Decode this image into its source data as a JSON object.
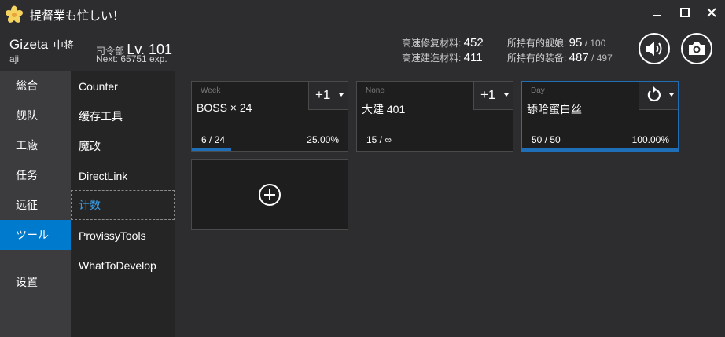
{
  "app": {
    "title": "提督業も忙しい！"
  },
  "admiral": {
    "name": "Gizeta",
    "rank": "中将",
    "comment": "aji",
    "hq_label": "司令部",
    "level": "Lv. 101",
    "next_exp": "Next: 65751 exp."
  },
  "resources": {
    "repair_label": "高速修复材料: ",
    "repair_value": "452",
    "build_label": "高速建造材料: ",
    "build_value": "411",
    "ships_label": "所持有的舰娘: ",
    "ships_value": "95",
    "ships_sep": " / ",
    "ships_max": "100",
    "equip_label": "所持有的装备: ",
    "equip_value": "487",
    "equip_sep": " / ",
    "equip_max": "497"
  },
  "nav_primary": [
    {
      "label": "総合",
      "active": false
    },
    {
      "label": "舰队",
      "active": false
    },
    {
      "label": "工廠",
      "active": false
    },
    {
      "label": "任务",
      "active": false
    },
    {
      "label": "远征",
      "active": false
    },
    {
      "label": "ツール",
      "active": true
    },
    {
      "label": "设置",
      "active": false
    }
  ],
  "nav_secondary": [
    {
      "label": "Counter"
    },
    {
      "label": "缓存工具"
    },
    {
      "label": "魔改"
    },
    {
      "label": "DirectLink"
    },
    {
      "label": "计数",
      "selected": true
    },
    {
      "label": "ProvissyTools"
    },
    {
      "label": "WhatToDevelop"
    }
  ],
  "counters": [
    {
      "type": "Week",
      "name": "BOSS × 24",
      "count": "6 / 24",
      "percent": "25.00%",
      "progress": 0.25,
      "button_label": "+1",
      "button_icon": "plus-one"
    },
    {
      "type": "None",
      "name": "大建 401",
      "count": "15 / ∞",
      "percent": "",
      "progress": 0,
      "button_label": "+1",
      "button_icon": "plus-one"
    },
    {
      "type": "Day",
      "name": "舔哈蜜白丝",
      "count": "50 / 50",
      "percent": "100.00%",
      "progress": 1.0,
      "button_label": "",
      "button_icon": "reset-icon"
    }
  ],
  "colors": {
    "accent": "#007acc",
    "progress": "#1e6fb8",
    "selected_text": "#3aa0e8"
  },
  "icons": {
    "app": "flower-icon",
    "sound": "speaker-icon",
    "screenshot": "camera-icon",
    "add": "plus-circle-icon"
  }
}
